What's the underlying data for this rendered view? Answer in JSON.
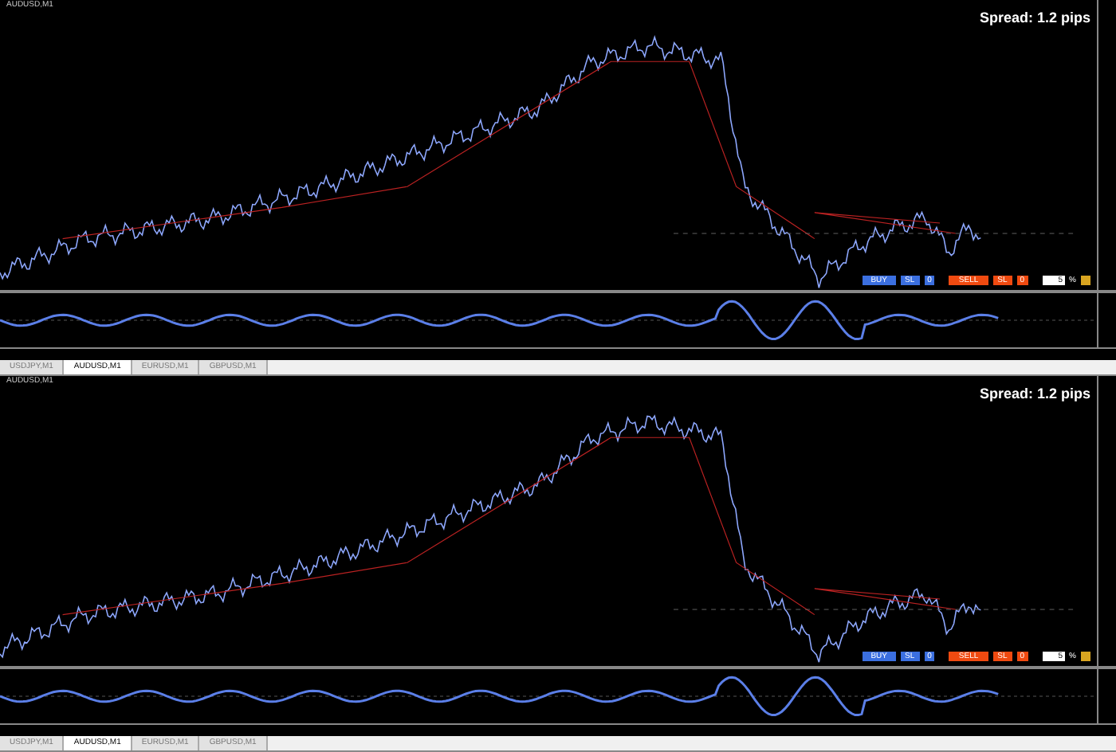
{
  "windows": [
    {
      "title": "AUDUSD,M1",
      "spread": "Spread: 1.2 pips",
      "trade_panel": {
        "buy": "BUY",
        "buy_sl": "SL",
        "buy_count": "0",
        "sell": "SELL",
        "sell_sl": "SL",
        "sell_count": "0",
        "risk_value": "5",
        "risk_unit": "%"
      },
      "tabs": [
        {
          "label": "USDJPY,M1",
          "selected": false
        },
        {
          "label": "AUDUSD,M1",
          "selected": true
        },
        {
          "label": "EURUSD,M1",
          "selected": false
        },
        {
          "label": "GBPUSD,M1",
          "selected": false
        }
      ]
    },
    {
      "title": "AUDUSD,M1",
      "spread": "Spread: 1.2 pips",
      "trade_panel": {
        "buy": "BUY",
        "buy_sl": "SL",
        "buy_count": "0",
        "sell": "SELL",
        "sell_sl": "SL",
        "sell_count": "0",
        "risk_value": "5",
        "risk_unit": "%"
      },
      "tabs": [
        {
          "label": "USDJPY,M1",
          "selected": false
        },
        {
          "label": "AUDUSD,M1",
          "selected": true
        },
        {
          "label": "EURUSD,M1",
          "selected": false
        },
        {
          "label": "GBPUSD,M1",
          "selected": false
        }
      ]
    }
  ]
}
